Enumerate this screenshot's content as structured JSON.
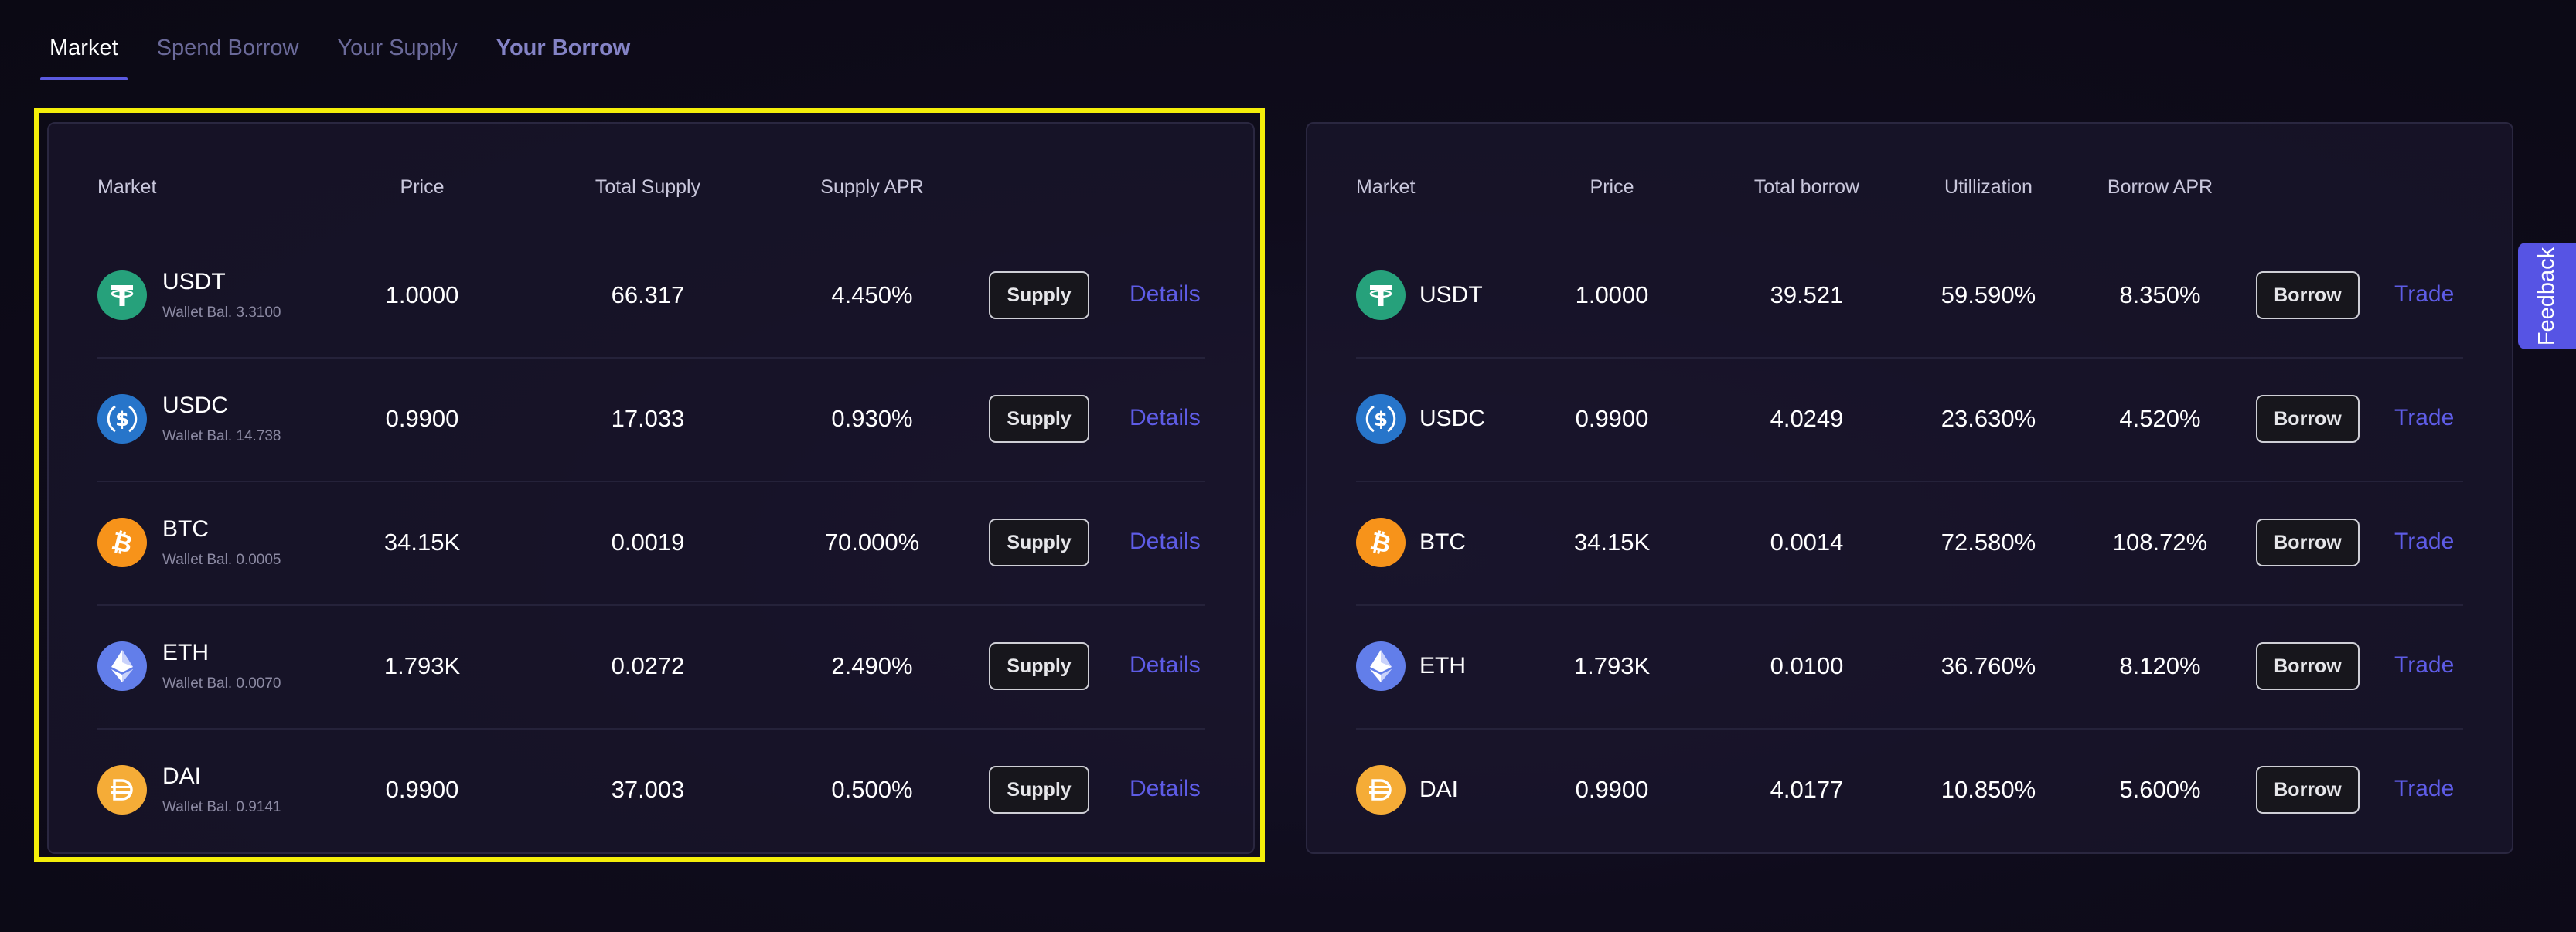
{
  "tabs": [
    {
      "label": "Market"
    },
    {
      "label": "Spend Borrow"
    },
    {
      "label": "Your Supply"
    },
    {
      "label": "Your Borrow"
    }
  ],
  "supply_table": {
    "headers": {
      "market": "Market",
      "price": "Price",
      "total": "Total Supply",
      "apr": "Supply APR"
    },
    "rows": [
      {
        "symbol": "USDT",
        "wallet": "Wallet Bal. 3.3100",
        "price": "1.0000",
        "total": "66.317",
        "apr": "4.450%",
        "action": "Supply",
        "link": "Details"
      },
      {
        "symbol": "USDC",
        "wallet": "Wallet Bal. 14.738",
        "price": "0.9900",
        "total": "17.033",
        "apr": "0.930%",
        "action": "Supply",
        "link": "Details"
      },
      {
        "symbol": "BTC",
        "wallet": "Wallet Bal. 0.0005",
        "price": "34.15K",
        "total": "0.0019",
        "apr": "70.000%",
        "action": "Supply",
        "link": "Details"
      },
      {
        "symbol": "ETH",
        "wallet": "Wallet Bal. 0.0070",
        "price": "1.793K",
        "total": "0.0272",
        "apr": "2.490%",
        "action": "Supply",
        "link": "Details"
      },
      {
        "symbol": "DAI",
        "wallet": "Wallet Bal. 0.9141",
        "price": "0.9900",
        "total": "37.003",
        "apr": "0.500%",
        "action": "Supply",
        "link": "Details"
      }
    ]
  },
  "borrow_table": {
    "headers": {
      "market": "Market",
      "price": "Price",
      "total": "Total borrow",
      "util": "Utillization",
      "apr": "Borrow APR"
    },
    "rows": [
      {
        "symbol": "USDT",
        "price": "1.0000",
        "total": "39.521",
        "util": "59.590%",
        "apr": "8.350%",
        "action": "Borrow",
        "link": "Trade"
      },
      {
        "symbol": "USDC",
        "price": "0.9900",
        "total": "4.0249",
        "util": "23.630%",
        "apr": "4.520%",
        "action": "Borrow",
        "link": "Trade"
      },
      {
        "symbol": "BTC",
        "price": "34.15K",
        "total": "0.0014",
        "util": "72.580%",
        "apr": "108.72%",
        "action": "Borrow",
        "link": "Trade"
      },
      {
        "symbol": "ETH",
        "price": "1.793K",
        "total": "0.0100",
        "util": "36.760%",
        "apr": "8.120%",
        "action": "Borrow",
        "link": "Trade"
      },
      {
        "symbol": "DAI",
        "price": "0.9900",
        "total": "4.0177",
        "util": "10.850%",
        "apr": "5.600%",
        "action": "Borrow",
        "link": "Trade"
      }
    ]
  },
  "coins": [
    {
      "symbol": "USDT",
      "icon": "tether-icon",
      "color": "#26a17b"
    },
    {
      "symbol": "USDC",
      "icon": "usd-coin-icon",
      "color": "#2775ca"
    },
    {
      "symbol": "BTC",
      "icon": "bitcoin-icon",
      "color": "#f7931a"
    },
    {
      "symbol": "ETH",
      "icon": "ethereum-icon",
      "color": "#627eea"
    },
    {
      "symbol": "DAI",
      "icon": "dai-icon",
      "color": "#f5ac37"
    }
  ],
  "feedback": {
    "label": "Feedback"
  },
  "colors": {
    "accent": "#5b5ae0",
    "link": "#5e5ce6",
    "highlight": "#f4ee0a",
    "background": "#0f0c1c"
  }
}
